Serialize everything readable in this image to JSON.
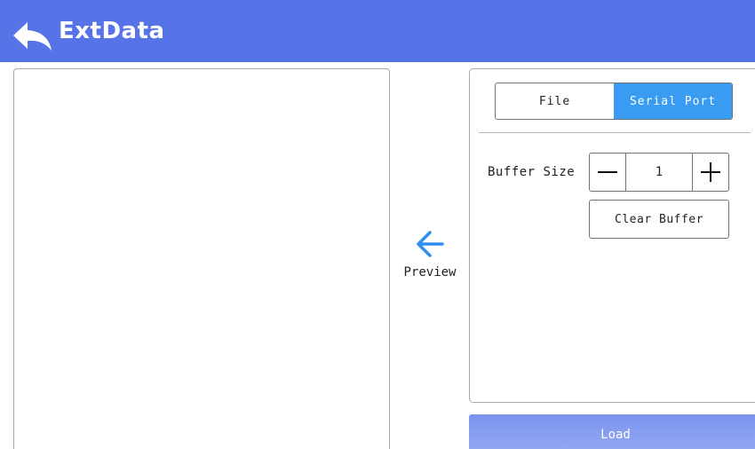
{
  "header": {
    "title": "ExtData",
    "back_icon": "back-arrow-icon",
    "background": "#5673e8"
  },
  "preview": {
    "label": "Preview",
    "icon": "arrow-left-icon",
    "icon_color": "#2f8ff0"
  },
  "source_tabs": [
    {
      "label": "File",
      "selected": false
    },
    {
      "label": "Serial Port",
      "selected": true
    }
  ],
  "buffer": {
    "label": "Buffer Size",
    "value": "1",
    "decrement_icon": "minus-icon",
    "increment_icon": "plus-icon"
  },
  "clear_buffer": {
    "label": "Clear Buffer"
  },
  "load": {
    "label": "Load"
  },
  "colors": {
    "accent": "#3a9bf2",
    "load_button": "#8aa0f0"
  }
}
